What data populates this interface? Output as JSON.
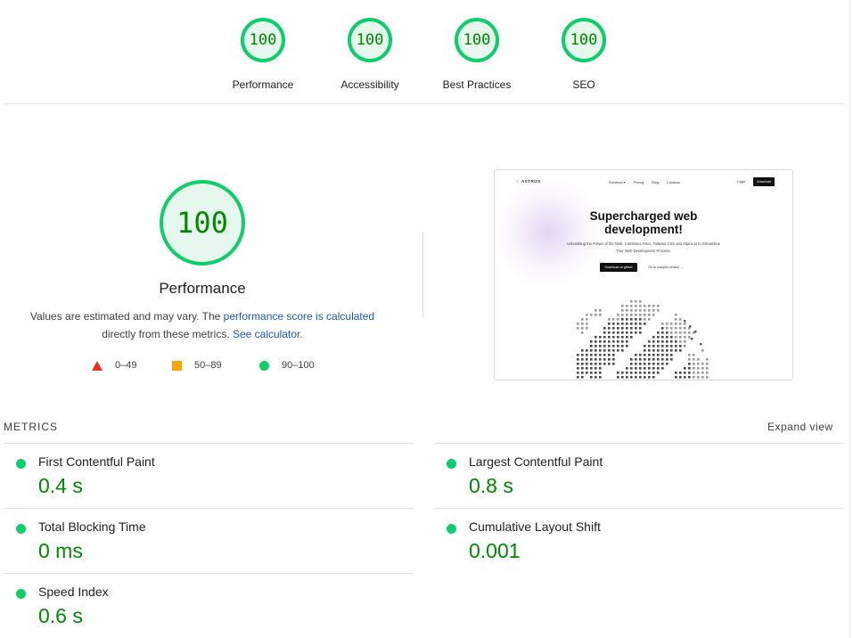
{
  "categories": [
    {
      "label": "Performance",
      "score": "100"
    },
    {
      "label": "Accessibility",
      "score": "100"
    },
    {
      "label": "Best Practices",
      "score": "100"
    },
    {
      "label": "SEO",
      "score": "100"
    }
  ],
  "main": {
    "score": "100",
    "title": "Performance",
    "desc_part1": "Values are estimated and may vary. The ",
    "desc_link1": "performance score is calculated",
    "desc_part2": "directly from these metrics. ",
    "desc_link2": "See calculator."
  },
  "legend": [
    {
      "range": "0–49",
      "color": "#eb3223"
    },
    {
      "range": "50–89",
      "color": "#ffa400"
    },
    {
      "range": "90–100",
      "color": "#0cce6b"
    }
  ],
  "thumbnail": {
    "logo": "ASTROS",
    "nav": [
      "Solutions ▾",
      "Pricing",
      "Blog",
      "Contacts"
    ],
    "login": "Login",
    "download": "Download",
    "headline": "Supercharged web development!",
    "subtext": "Unleashing the Power of the Web: Combines Astro, Tailwind CSS and Alpine.js to Streamline Your Web Development Process.",
    "primary_button": "Download on github",
    "secondary_button": "Go to unstyled version →"
  },
  "metrics": {
    "heading": "METRICS",
    "expand_label": "Expand view",
    "items": [
      {
        "label": "First Contentful Paint",
        "value": "0.4 s"
      },
      {
        "label": "Largest Contentful Paint",
        "value": "0.8 s"
      },
      {
        "label": "Total Blocking Time",
        "value": "0 ms"
      },
      {
        "label": "Cumulative Layout Shift",
        "value": "0.001"
      },
      {
        "label": "Speed Index",
        "value": "0.6 s"
      }
    ]
  },
  "colors": {
    "pass": "#0cce6b",
    "pass_text": "#008800",
    "link": "#1a57c0"
  }
}
